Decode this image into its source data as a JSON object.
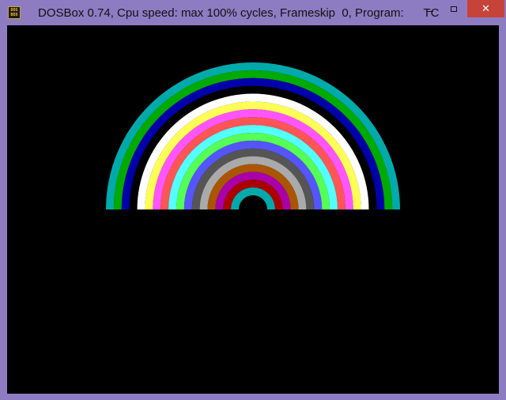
{
  "window": {
    "title": "DOSBox 0.74, Cpu speed: max 100% cycles, Frameskip  0, Program:      TC",
    "icon_label_top": "DOS",
    "icon_label_bottom": "BOX",
    "controls": {
      "minimize": "minimize-icon",
      "maximize": "maximize-icon",
      "close": "close-icon",
      "close_symbol": "✕"
    }
  },
  "rainbow": {
    "background": "#000000",
    "bands_outer_to_inner": [
      "#00aaaa",
      "#00aa00",
      "#0000aa",
      "#000000",
      "#ffffff",
      "#ffff55",
      "#ff55ff",
      "#ff5555",
      "#55ffff",
      "#55ff55",
      "#5555ff",
      "#555555",
      "#aaaaaa",
      "#aa5500",
      "#aa00aa",
      "#aa0000",
      "#00aaaa"
    ]
  }
}
